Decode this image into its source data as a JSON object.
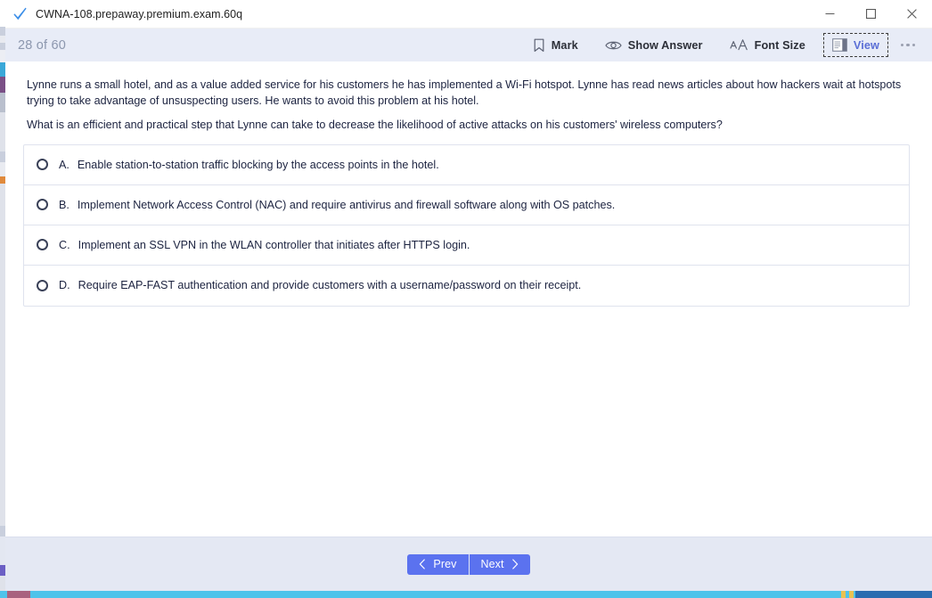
{
  "window": {
    "title": "CWNA-108.prepaway.premium.exam.60q",
    "app_icon": "blue-check-icon",
    "controls": {
      "minimize": "minimize-icon",
      "maximize": "maximize-icon",
      "close": "close-icon"
    }
  },
  "toolbar": {
    "question_counter": "28 of 60",
    "actions": [
      {
        "label": "Mark",
        "icon": "bookmark-icon",
        "focused": false
      },
      {
        "label": "Show Answer",
        "icon": "eye-icon",
        "focused": false
      },
      {
        "label": "Font Size",
        "icon": "font-size-icon",
        "focused": false
      },
      {
        "label": "View",
        "icon": "view-pane-icon",
        "focused": true
      }
    ],
    "overflow_label": "More options",
    "accent_color": "#5b6fd6",
    "background_color": "#e8ecf7"
  },
  "question": {
    "scenario": "Lynne runs a small hotel, and as a value added service for his customers he has implemented a Wi-Fi hotspot. Lynne has read news articles about how hackers wait at hotspots trying to take advantage of unsuspecting users. He wants to avoid this problem at his hotel.",
    "prompt": "What is an efficient and practical step that Lynne can take to decrease the likelihood of active attacks on his customers' wireless computers?",
    "options": [
      {
        "letter": "A.",
        "text": "Enable station-to-station traffic blocking by the access points in the hotel.",
        "selected": false
      },
      {
        "letter": "B.",
        "text": "Implement Network Access Control (NAC) and require antivirus and firewall software along with OS patches.",
        "selected": false
      },
      {
        "letter": "C.",
        "text": "Implement an SSL VPN in the WLAN controller that initiates after HTTPS login.",
        "selected": false
      },
      {
        "letter": "D.",
        "text": "Require EAP-FAST authentication and provide customers with a username/password on their receipt.",
        "selected": false
      }
    ]
  },
  "footer": {
    "prev_label": "Prev",
    "next_label": "Next",
    "button_color": "#5b72ef",
    "background_color": "#e4e8f3"
  }
}
